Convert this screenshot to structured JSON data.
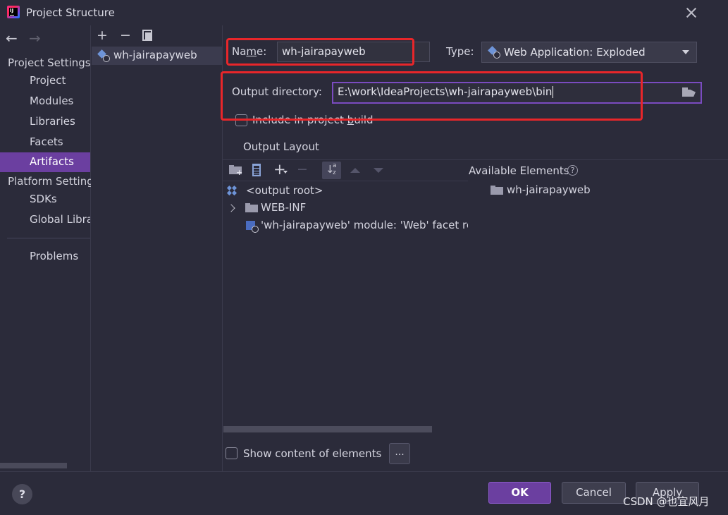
{
  "window": {
    "title": "Project Structure"
  },
  "nav": {
    "back_icon": "arrow-left-icon",
    "forward_icon": "arrow-right-icon",
    "project_settings_heading": "Project Settings",
    "project_settings_items": [
      "Project",
      "Modules",
      "Libraries",
      "Facets",
      "Artifacts"
    ],
    "platform_settings_heading": "Platform Settings",
    "platform_settings_items": [
      "SDKs",
      "Global Libraries"
    ],
    "problems": "Problems",
    "selected": "Artifacts"
  },
  "artifacts_list": {
    "toolbar": {
      "add": "+",
      "remove": "−"
    },
    "items": [
      "wh-jairapayweb"
    ]
  },
  "artifact": {
    "name_label_pre": "Na",
    "name_label_mnemonic": "m",
    "name_label_post": "e:",
    "name_value": "wh-jairapayweb",
    "type_label": "Type:",
    "type_value": "Web Application: Exploded",
    "output_dir_label": "Output directory:",
    "output_dir_value": "E:\\work\\IdeaProjects\\wh-jairapayweb\\bin",
    "include_build_pre": "Include in project ",
    "include_build_mnemonic": "b",
    "include_build_post": "uild",
    "include_build_checked": false,
    "output_layout_label": "Output Layout",
    "available_elements_label": "Available Elements",
    "tree": {
      "root": "<output root>",
      "folder": "WEB-INF",
      "facet": "'wh-jairapayweb' module: 'Web' facet res"
    },
    "available": [
      "wh-jairapayweb"
    ],
    "show_content_label": "Show content of elements",
    "show_content_checked": false,
    "dots_label": "..."
  },
  "footer": {
    "help": "?",
    "ok": "OK",
    "cancel": "Cancel",
    "apply": "Apply"
  },
  "watermark": "CSDN @也宜风月",
  "colors": {
    "accent": "#6b3fa0",
    "highlight_box": "#e8262a",
    "background": "#2b2b3a"
  }
}
